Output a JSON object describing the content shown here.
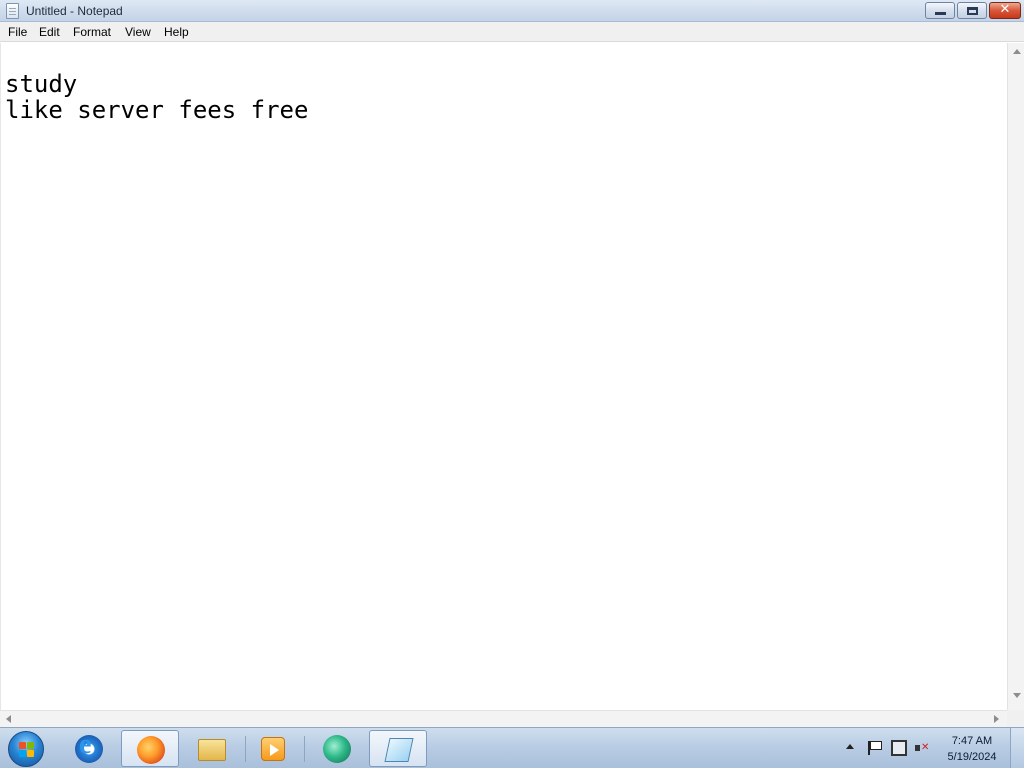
{
  "window": {
    "title": "Untitled - Notepad",
    "controls": {
      "minimize": "minimize",
      "maximize": "restore",
      "close": "✕"
    }
  },
  "menu": {
    "items": [
      "File",
      "Edit",
      "Format",
      "View",
      "Help"
    ]
  },
  "editor": {
    "lines": [
      "study",
      "like server fees free"
    ]
  },
  "taskbar": {
    "apps": [
      {
        "name": "Internet Explorer",
        "icon": "ie-icon"
      },
      {
        "name": "Firefox",
        "icon": "firefox-icon"
      },
      {
        "name": "Windows Explorer",
        "icon": "folder-icon"
      },
      {
        "name": "Windows Media Player",
        "icon": "media-player-icon"
      },
      {
        "name": "Chat",
        "icon": "chat-icon"
      },
      {
        "name": "Notepad",
        "icon": "notepad-icon"
      }
    ],
    "tray": {
      "icons": [
        "show-hidden-icons-icon",
        "action-center-flag-icon",
        "network-icon",
        "volume-muted-icon"
      ],
      "time": "7:47 AM",
      "date": "5/19/2024"
    }
  },
  "colors": {
    "titlebar": "#cfdcec",
    "close_button": "#d9573b",
    "taskbar": "#b9cde4"
  }
}
